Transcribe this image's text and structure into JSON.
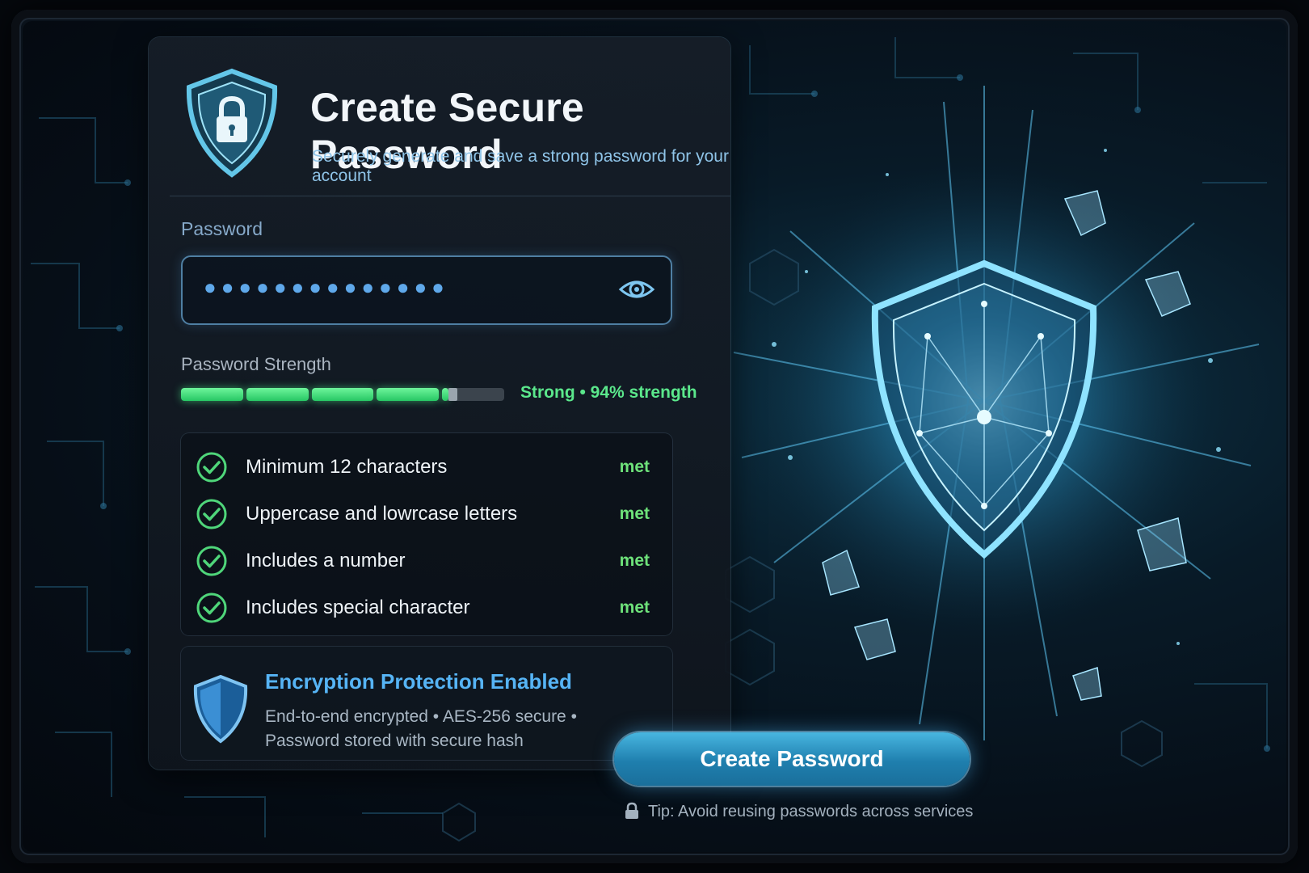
{
  "header": {
    "title": "Create Secure Password",
    "subtitle": "Securely generate and save a strong password for your account",
    "icon": "shield-lock-icon"
  },
  "password": {
    "label": "Password",
    "masked_value": "●●●●●●●●●●●●●●",
    "toggle_icon": "eye-icon"
  },
  "strength": {
    "label": "Password Strength",
    "text": "Strong • 94% strength",
    "percent": 94,
    "segments_total": 5,
    "color": "#4fe07f"
  },
  "requirements": [
    {
      "text": "Minimum 12 characters",
      "status": "met"
    },
    {
      "text": "Uppercase and lowrcase letters",
      "status": "met"
    },
    {
      "text": "Includes a number",
      "status": "met"
    },
    {
      "text": "Includes special character",
      "status": "met"
    }
  ],
  "encryption": {
    "title": "Encryption Protection Enabled",
    "description": "End-to-end encrypted • AES-256 secure • Password stored with secure hash",
    "icon": "shield-icon"
  },
  "actions": {
    "create_label": "Create Password"
  },
  "tip": {
    "text": "Tip: Avoid reusing passwords across services",
    "icon": "lock-icon"
  },
  "colors": {
    "accent": "#48b6e0",
    "success": "#6ee27a",
    "background": "#060e17"
  }
}
